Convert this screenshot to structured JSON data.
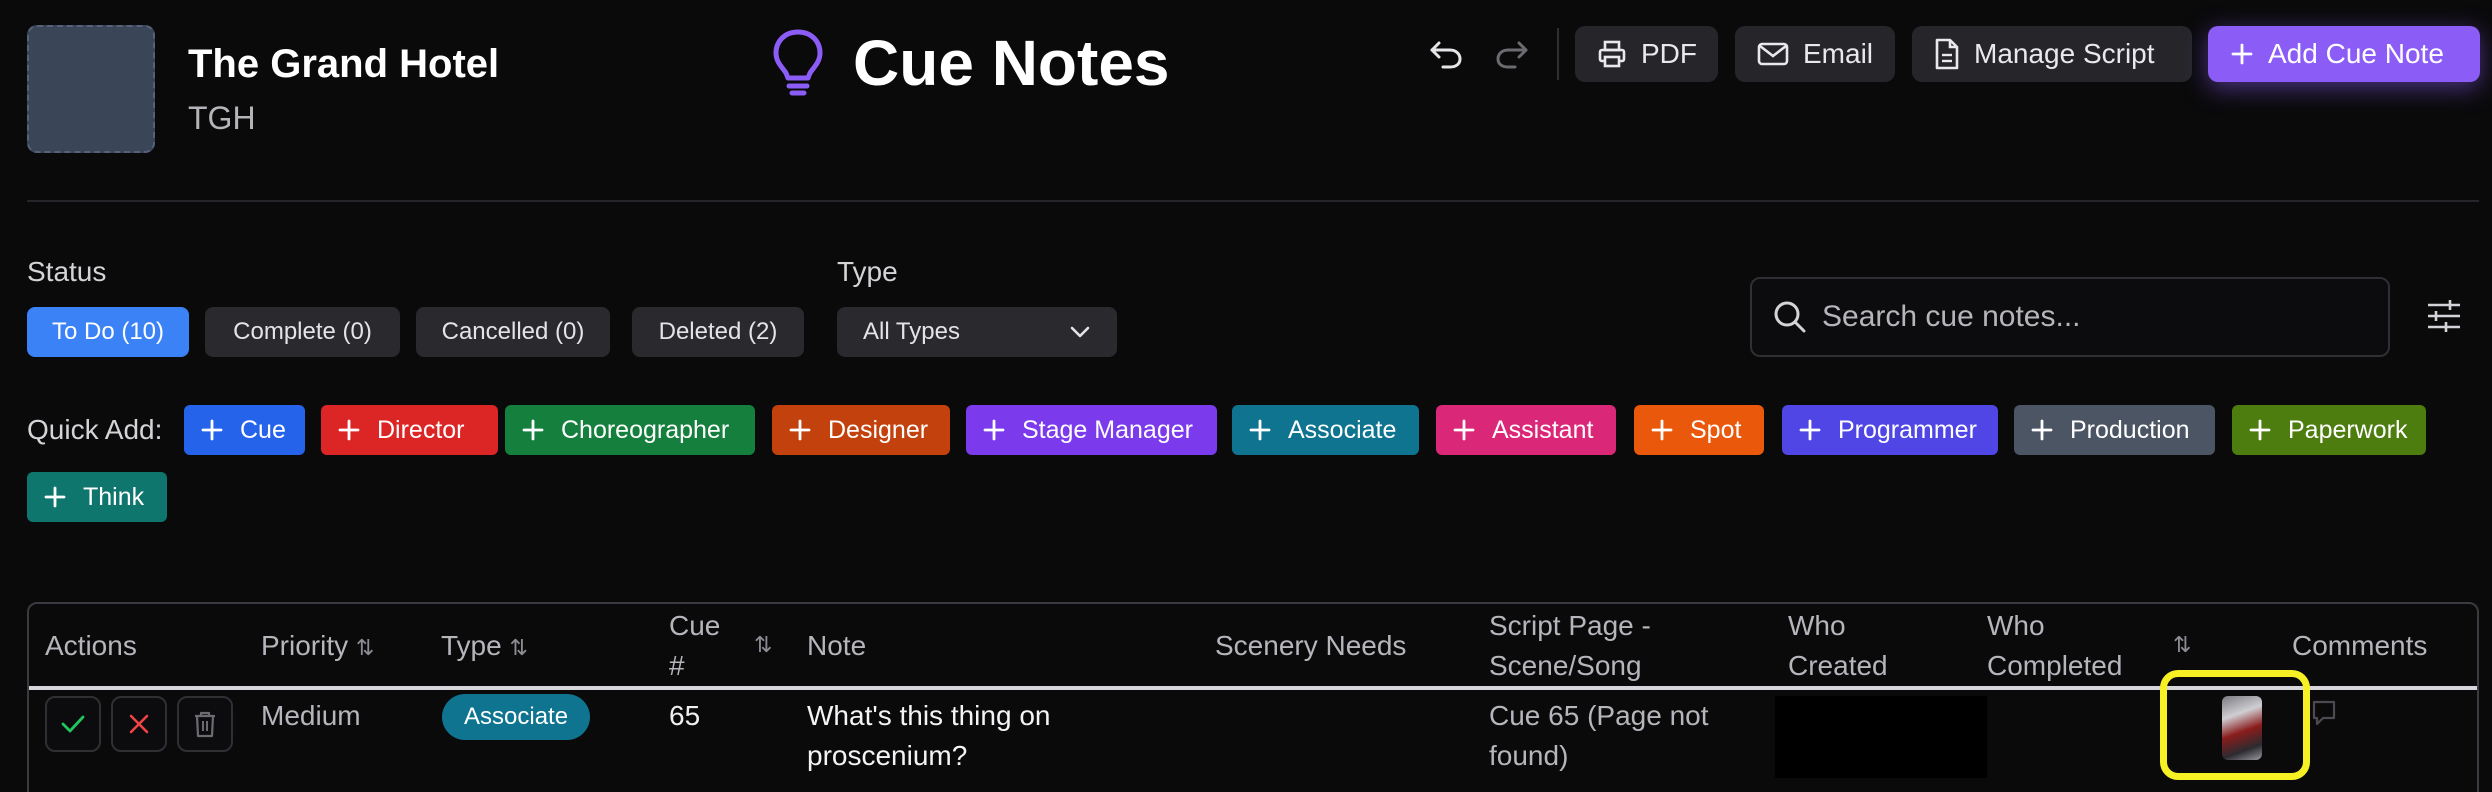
{
  "header": {
    "production_name": "The Grand Hotel",
    "production_code": "TGH",
    "page_title": "Cue Notes",
    "buttons": {
      "pdf": "PDF",
      "email": "Email",
      "manage_script": "Manage Script",
      "add_cue_note": "Add Cue Note"
    }
  },
  "filters": {
    "status_label": "Status",
    "status_options": [
      "To Do (10)",
      "Complete (0)",
      "Cancelled (0)",
      "Deleted (2)"
    ],
    "type_label": "Type",
    "type_selected": "All Types",
    "search_placeholder": "Search cue notes..."
  },
  "quick_add": {
    "label": "Quick Add:",
    "items": [
      {
        "label": "Cue",
        "color": "#2563eb"
      },
      {
        "label": "Director",
        "color": "#dc2626"
      },
      {
        "label": "Choreographer",
        "color": "#15803d"
      },
      {
        "label": "Designer",
        "color": "#c2410c"
      },
      {
        "label": "Stage Manager",
        "color": "#7c3aed"
      },
      {
        "label": "Associate",
        "color": "#0e7490"
      },
      {
        "label": "Assistant",
        "color": "#db2777"
      },
      {
        "label": "Spot",
        "color": "#ea580c"
      },
      {
        "label": "Programmer",
        "color": "#4f46e5"
      },
      {
        "label": "Production",
        "color": "#4b5563"
      },
      {
        "label": "Paperwork",
        "color": "#4d7c0f"
      },
      {
        "label": "Think",
        "color": "#0f766e"
      }
    ]
  },
  "table": {
    "columns": {
      "actions": "Actions",
      "priority": "Priority",
      "type": "Type",
      "cue_num_1": "Cue",
      "cue_num_2": "#",
      "note": "Note",
      "scenery_needs": "Scenery Needs",
      "script_page_1": "Script Page -",
      "script_page_2": "Scene/Song",
      "who_created_1": "Who",
      "who_created_2": "Created",
      "who_completed_1": "Who",
      "who_completed_2": "Completed",
      "comments": "Comments"
    },
    "rows": [
      {
        "priority": "Medium",
        "type": "Associate",
        "cue_number": "65",
        "note_line1": "What's this thing on",
        "note_line2": "proscenium?",
        "scenery_needs": "",
        "script_line1": "Cue 65 (Page not",
        "script_line2": "found)"
      }
    ]
  },
  "colors": {
    "accent": "#8b5cf6",
    "active_status": "#3b82f6",
    "highlight": "#f6f025"
  }
}
